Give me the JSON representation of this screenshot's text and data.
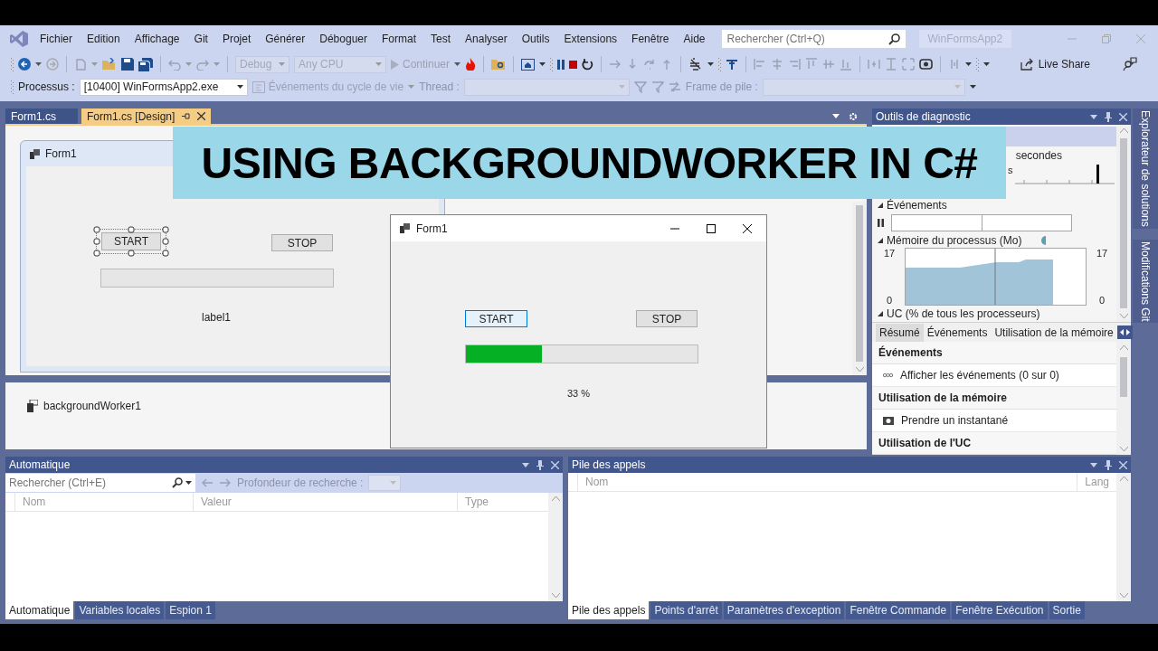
{
  "menu_bar": {
    "items": [
      "Fichier",
      "Edition",
      "Affichage",
      "Git",
      "Projet",
      "Générer",
      "Déboguer",
      "Format",
      "Test",
      "Analyser",
      "Outils",
      "Extensions",
      "Fenêtre",
      "Aide"
    ],
    "search": {
      "placeholder": "Rechercher (Ctrl+Q)"
    },
    "solution_name": "WinFormsApp2"
  },
  "toolbar": {
    "configuration": "Debug",
    "platform": "Any CPU",
    "continue": "Continuer",
    "live_share": "Live Share"
  },
  "debug_toolbar": {
    "process_label": "Processus :",
    "process": "[10400] WinFormsApp2.exe",
    "lifecycle_events": "Événements du cycle de vie",
    "thread_label": "Thread :",
    "stack_frame_label": "Frame de pile :"
  },
  "document_tabs": [
    {
      "label": "Form1.cs",
      "selected": false
    },
    {
      "label": "Form1.cs [Design]",
      "selected": true
    }
  ],
  "designer": {
    "form_title": "Form1",
    "start_button": {
      "text": "START",
      "selected": true
    },
    "stop_button": {
      "text": "STOP",
      "selected": false
    },
    "progress": {
      "level": 0
    },
    "label": "label1",
    "components": [
      "backgroundWorker1"
    ]
  },
  "running_form": {
    "title": "Form1",
    "start_button": {
      "text": "START",
      "focused": true
    },
    "stop_button": {
      "text": "STOP",
      "focused": false
    },
    "progress": {
      "level": 0.33
    },
    "status": "33 %"
  },
  "banner": "USING BACKGROUNDWORKER IN C#",
  "diagnostics": {
    "title": "Outils de diagnostic",
    "timeline_unit": "secondes",
    "ruler_label": "s",
    "events_title": "Événements",
    "memory_title": "Mémoire du processus (Mo)",
    "memory_axis_left": {
      "max": "17",
      "min": "0"
    },
    "memory_axis_right": {
      "max": "17",
      "min": "0"
    },
    "cpu_title": "UC (% de tous les processeurs)",
    "tabs": [
      {
        "label": "Résumé",
        "selected": true
      },
      {
        "label": "Événements",
        "selected": false
      },
      {
        "label": "Utilisation de la mémoire",
        "selected": false
      }
    ],
    "summary": [
      {
        "kind": "header",
        "text": "Événements"
      },
      {
        "kind": "events",
        "text": "Afficher les événements (0 sur 0)"
      },
      {
        "kind": "header",
        "text": "Utilisation de la mémoire"
      },
      {
        "kind": "snapshot",
        "text": "Prendre un instantané"
      },
      {
        "kind": "header",
        "text": "Utilisation de l'UC"
      }
    ]
  },
  "side_tabs": [
    "Explorateur de solutions",
    "Modifications Git"
  ],
  "autos_panel": {
    "title": "Automatique",
    "search": {
      "placeholder": "Rechercher (Ctrl+E)"
    },
    "depth_label": "Profondeur de recherche :",
    "columns": [
      "Nom",
      "Valeur",
      "Type"
    ],
    "tabs": [
      {
        "label": "Automatique",
        "selected": true
      },
      {
        "label": "Variables locales",
        "selected": false
      },
      {
        "label": "Espion 1",
        "selected": false
      }
    ]
  },
  "call_stack_panel": {
    "title": "Pile des appels",
    "columns": [
      "Nom",
      "Lang"
    ],
    "tabs": [
      {
        "label": "Pile des appels",
        "selected": true
      },
      {
        "label": "Points d'arrêt",
        "selected": false
      },
      {
        "label": "Paramètres d'exception",
        "selected": false
      },
      {
        "label": "Fenêtre Commande",
        "selected": false
      },
      {
        "label": "Fenêtre Exécution",
        "selected": false
      },
      {
        "label": "Sortie",
        "selected": false
      }
    ]
  }
}
